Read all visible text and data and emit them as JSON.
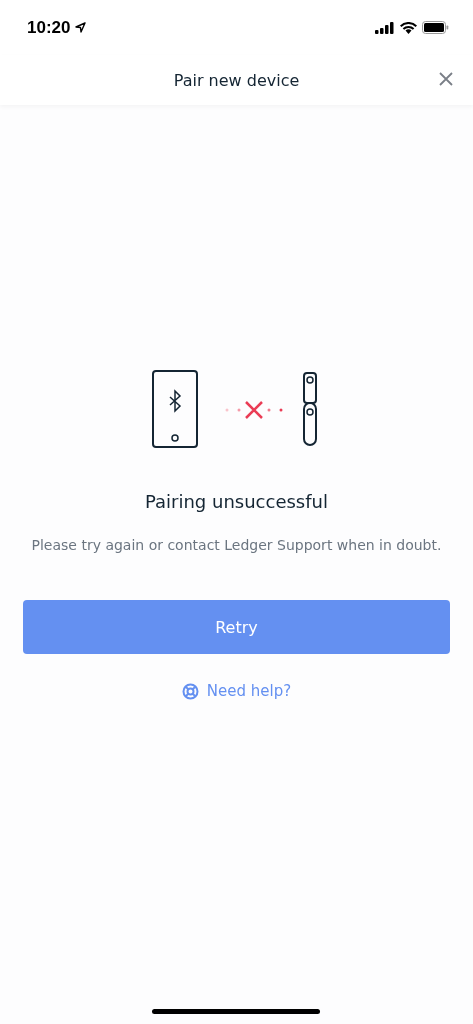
{
  "status_bar": {
    "time": "10:20"
  },
  "header": {
    "title": "Pair new device"
  },
  "result": {
    "title": "Pairing unsuccessful",
    "message": "Please try again or contact Ledger Support when in doubt."
  },
  "buttons": {
    "retry": "Retry",
    "help": "Need help?"
  }
}
